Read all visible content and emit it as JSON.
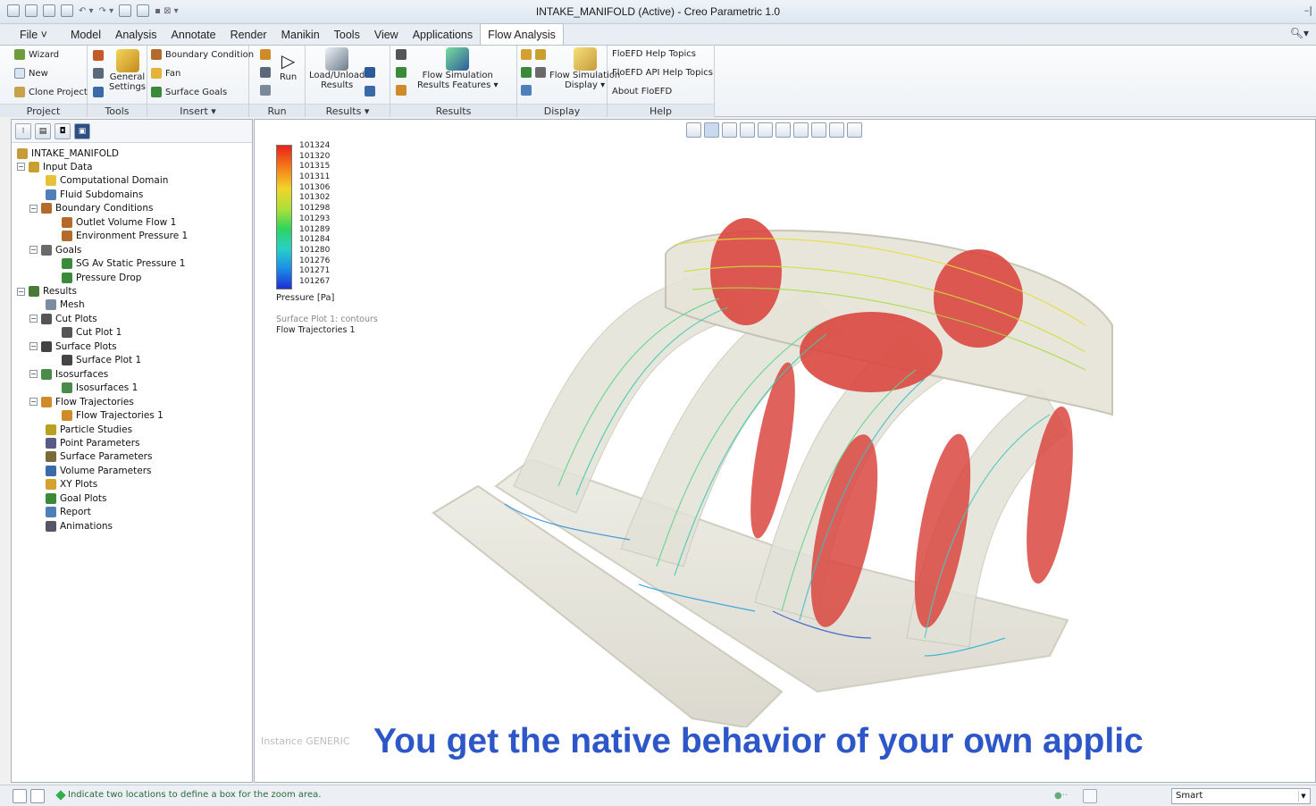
{
  "window": {
    "title": "INTAKE_MANIFOLD (Active) - Creo Parametric 1.0"
  },
  "tabs": [
    "File",
    "Model",
    "Analysis",
    "Annotate",
    "Render",
    "Manikin",
    "Tools",
    "View",
    "Applications",
    "Flow Analysis"
  ],
  "active_tab": "Flow Analysis",
  "ribbon": {
    "project": {
      "label": "Project",
      "wizard": "Wizard",
      "new": "New",
      "clone": "Clone Project"
    },
    "tools": {
      "label": "Tools",
      "general_settings_1": "General",
      "general_settings_2": "Settings"
    },
    "insert": {
      "label": "Insert ▾",
      "boundary": "Boundary Condition",
      "fan": "Fan",
      "surface_goals": "Surface Goals"
    },
    "run": {
      "label": "Run",
      "run": "Run"
    },
    "results_group": {
      "label": "Results ▾",
      "load_1": "Load/Unload",
      "load_2": "Results"
    },
    "results2": {
      "label": "Results",
      "fs_1": "Flow Simulation",
      "fs_2": "Results Features ▾"
    },
    "display": {
      "label": "Display",
      "fsd_1": "Flow Simulation",
      "fsd_2": "Display ▾"
    },
    "help": {
      "label": "Help",
      "topics": "FloEFD Help Topics",
      "api": "FloEFD API Help Topics",
      "about": "About FloEFD"
    }
  },
  "tree": [
    {
      "label": "INTAKE_MANIFOLD",
      "level": 0,
      "expander": "",
      "icon": "model-icon",
      "color": "#c79a3a"
    },
    {
      "label": "Input Data",
      "level": 0,
      "expander": "−",
      "icon": "folder-icon",
      "color": "#c9a02e"
    },
    {
      "label": "Computational Domain",
      "level": 2,
      "expander": "",
      "icon": "domain-icon",
      "color": "#e6c23a"
    },
    {
      "label": "Fluid Subdomains",
      "level": 2,
      "expander": "",
      "icon": "subdomain-icon",
      "color": "#4f7fb8"
    },
    {
      "label": "Boundary Conditions",
      "level": 1,
      "expander": "−",
      "icon": "boundary-icon",
      "color": "#b46a2a"
    },
    {
      "label": "Outlet Volume Flow 1",
      "level": 3,
      "expander": "",
      "icon": "flow-icon",
      "color": "#b46a2a"
    },
    {
      "label": "Environment Pressure 1",
      "level": 3,
      "expander": "",
      "icon": "pressure-icon",
      "color": "#b46a2a"
    },
    {
      "label": "Goals",
      "level": 1,
      "expander": "−",
      "icon": "goals-icon",
      "color": "#6a6a6a"
    },
    {
      "label": "SG Av Static Pressure 1",
      "level": 3,
      "expander": "",
      "icon": "goal-icon",
      "color": "#3a8a3a"
    },
    {
      "label": "Pressure Drop",
      "level": 3,
      "expander": "",
      "icon": "goal-icon",
      "color": "#3a8a3a"
    },
    {
      "label": "Results",
      "level": 0,
      "expander": "−",
      "icon": "results-icon",
      "color": "#4a7a3a"
    },
    {
      "label": "Mesh",
      "level": 2,
      "expander": "",
      "icon": "mesh-icon",
      "color": "#7b8ca0"
    },
    {
      "label": "Cut Plots",
      "level": 1,
      "expander": "−",
      "icon": "cutplot-icon",
      "color": "#555"
    },
    {
      "label": "Cut Plot 1",
      "level": 3,
      "expander": "",
      "icon": "cutplot-icon",
      "color": "#555"
    },
    {
      "label": "Surface Plots",
      "level": 1,
      "expander": "−",
      "icon": "surfaceplot-icon",
      "color": "#444"
    },
    {
      "label": "Surface Plot 1",
      "level": 3,
      "expander": "",
      "icon": "surfaceplot-icon",
      "color": "#444"
    },
    {
      "label": "Isosurfaces",
      "level": 1,
      "expander": "−",
      "icon": "isosurface-icon",
      "color": "#4a8a4a"
    },
    {
      "label": "Isosurfaces 1",
      "level": 3,
      "expander": "",
      "icon": "isosurface-icon",
      "color": "#4a8a4a"
    },
    {
      "label": "Flow Trajectories",
      "level": 1,
      "expander": "−",
      "icon": "trajectory-icon",
      "color": "#d08a2a"
    },
    {
      "label": "Flow Trajectories 1",
      "level": 3,
      "expander": "",
      "icon": "trajectory-icon",
      "color": "#d08a2a"
    },
    {
      "label": "Particle Studies",
      "level": 2,
      "expander": "",
      "icon": "particle-icon",
      "color": "#b8a020"
    },
    {
      "label": "Point Parameters",
      "level": 2,
      "expander": "",
      "icon": "point-icon",
      "color": "#5a5a8a"
    },
    {
      "label": "Surface Parameters",
      "level": 2,
      "expander": "",
      "icon": "surfaceparam-icon",
      "color": "#7a6a3a"
    },
    {
      "label": "Volume Parameters",
      "level": 2,
      "expander": "",
      "icon": "volume-icon",
      "color": "#3a6aa8"
    },
    {
      "label": "XY Plots",
      "level": 2,
      "expander": "",
      "icon": "xyplot-icon",
      "color": "#d4a030"
    },
    {
      "label": "Goal Plots",
      "level": 2,
      "expander": "",
      "icon": "goalplot-icon",
      "color": "#3a8a3a"
    },
    {
      "label": "Report",
      "level": 2,
      "expander": "",
      "icon": "report-icon",
      "color": "#4f7fb8"
    },
    {
      "label": "Animations",
      "level": 2,
      "expander": "",
      "icon": "animation-icon",
      "color": "#556"
    }
  ],
  "legend": {
    "values": [
      "101324",
      "101320",
      "101315",
      "101311",
      "101306",
      "101302",
      "101298",
      "101293",
      "101289",
      "101284",
      "101280",
      "101276",
      "101271",
      "101267"
    ],
    "unit": "Pressure [Pa]",
    "plot_info_1": "Surface Plot 1: contours",
    "plot_info_2": "Flow Trajectories 1"
  },
  "viewport": {
    "instance": "Instance GENERIC",
    "caption": "You get the native behavior of your own applic"
  },
  "statusbar": {
    "message": "Indicate two locations to define a box for the zoom area.",
    "selection_filter": "Smart"
  }
}
